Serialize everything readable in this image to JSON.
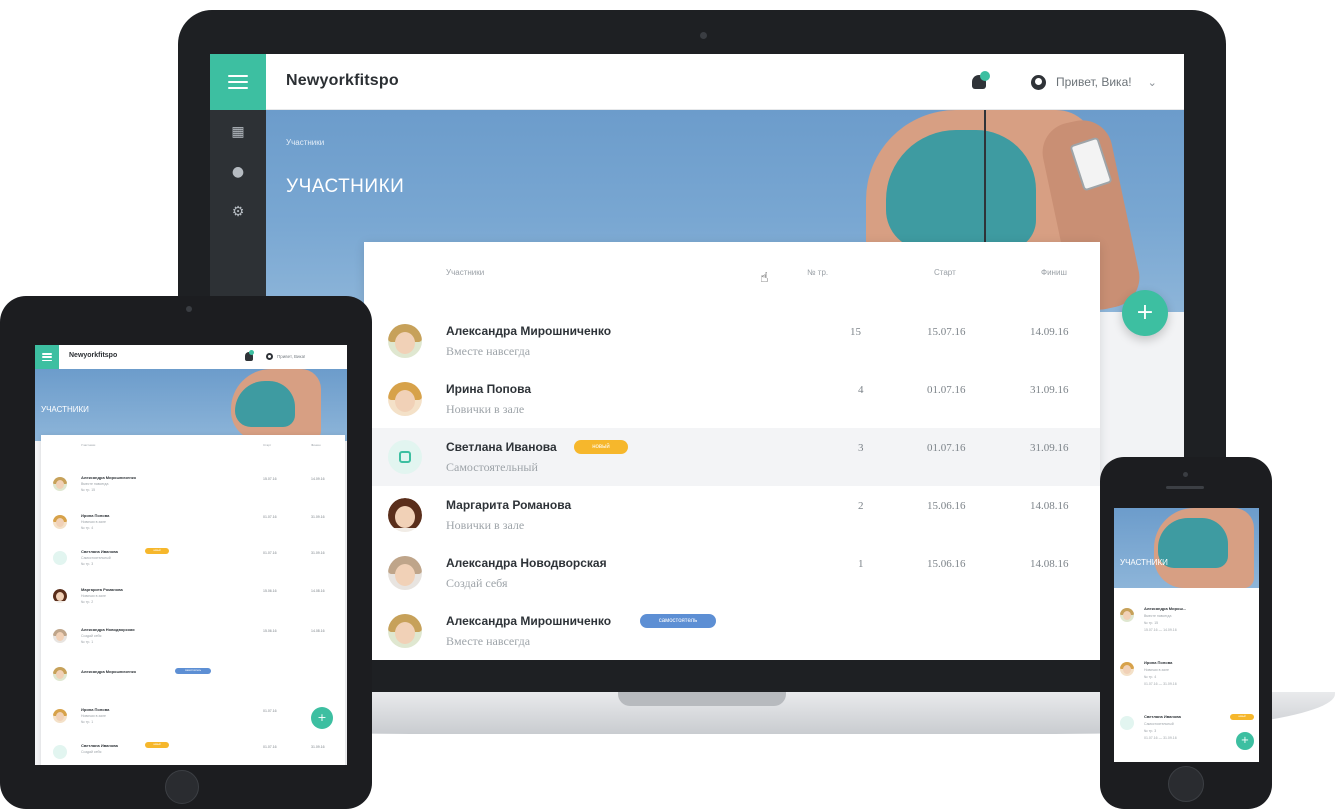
{
  "app": {
    "brand": "Newyorkfitspo",
    "greeting": "Привет, Вика!",
    "breadcrumb": "Участники",
    "page_title": "УЧАСТНИКИ",
    "accent_color": "#3dbfa1",
    "sidebar_icons": [
      "grid-icon",
      "user-icon",
      "gear-icon"
    ]
  },
  "table": {
    "headers": [
      "Участники",
      "№ тр.",
      "Старт",
      "Финиш"
    ],
    "rows": [
      {
        "name": "Александра Мирошниченко",
        "subtitle": "Вместе навсегда",
        "count": "15",
        "start": "15.07.16",
        "finish": "14.09.16",
        "badge": ""
      },
      {
        "name": "Ирина Попова",
        "subtitle": "Новички в зале",
        "count": "4",
        "start": "01.07.16",
        "finish": "31.09.16",
        "badge": ""
      },
      {
        "name": "Светлана Иванова",
        "subtitle": "Самостоятельный",
        "count": "3",
        "start": "01.07.16",
        "finish": "31.09.16",
        "badge": "новый"
      },
      {
        "name": "Маргарита Романова",
        "subtitle": "Новички в зале",
        "count": "2",
        "start": "15.06.16",
        "finish": "14.08.16",
        "badge": ""
      },
      {
        "name": "Александра Новодворская",
        "subtitle": "Создай себя",
        "count": "1",
        "start": "15.06.16",
        "finish": "14.08.16",
        "badge": ""
      },
      {
        "name": "Александра Мирошниченко",
        "subtitle": "Вместе навсегда",
        "count": "",
        "start": "",
        "finish": "",
        "badge": "самостоятель"
      }
    ]
  },
  "tablet": {
    "brand": "Newyorkfitspo",
    "greeting": "Привет, Вика!",
    "title": "УЧАСТНИКИ",
    "headers": [
      "Участники",
      "Старт",
      "Финиш"
    ],
    "rows": [
      {
        "name": "Александра Мирошниченко",
        "subtitle": "Вместе навсегда",
        "meta": "№ тр. 15",
        "start": "15.07.16",
        "finish": "14.09.16"
      },
      {
        "name": "Ирина Попова",
        "subtitle": "Новички в зале",
        "meta": "№ тр. 4",
        "start": "01.07.16",
        "finish": "31.09.16"
      },
      {
        "name": "Светлана Иванова",
        "subtitle": "Самостоятельный",
        "meta": "№ тр. 3",
        "start": "01.07.16",
        "finish": "31.09.16",
        "badge": "новый"
      },
      {
        "name": "Маргарита Романова",
        "subtitle": "Новички в зале",
        "meta": "№ тр. 2",
        "start": "15.06.16",
        "finish": "14.08.16"
      },
      {
        "name": "Александра Новодворская",
        "subtitle": "Создай себя",
        "meta": "№ тр. 1",
        "start": "15.06.16",
        "finish": "14.08.16"
      },
      {
        "name": "Александра Мирошниченко",
        "subtitle": "",
        "meta": "",
        "start": "",
        "finish": "",
        "badge": "самостоятель"
      },
      {
        "name": "Ирина Попова",
        "subtitle": "Новички в зале",
        "meta": "№ тр. 1",
        "start": "01.07.16",
        "finish": ""
      },
      {
        "name": "Светлана Иванова",
        "subtitle": "Создай себя",
        "meta": "",
        "start": "01.07.16",
        "finish": "31.09.16",
        "badge": "новый"
      }
    ]
  },
  "phone": {
    "title": "УЧАСТНИКИ",
    "rows": [
      {
        "name": "Александра Мирош...",
        "subtitle": "Вместе навсегда",
        "meta": "№ тр. 15",
        "dates": "15.07.16 — 14.09.16"
      },
      {
        "name": "Ирина Попова",
        "subtitle": "Новички в зале",
        "meta": "№ тр. 4",
        "dates": "01.07.16 — 31.09.16"
      },
      {
        "name": "Светлана Иванова",
        "subtitle": "Самостоятельный",
        "meta": "№ тр. 3",
        "dates": "01.07.16 — 31.09.16",
        "badge": "новый"
      }
    ]
  },
  "fab_label": "+"
}
